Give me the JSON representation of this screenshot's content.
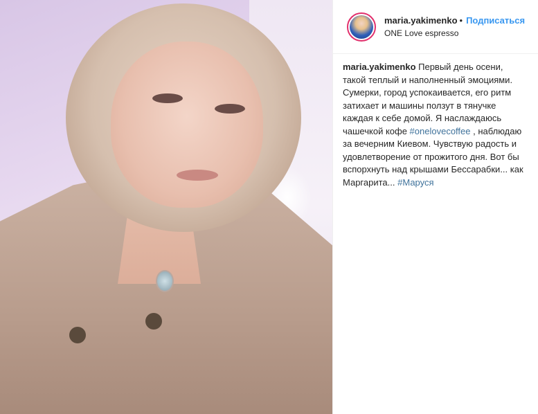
{
  "post": {
    "username": "maria.yakimenko",
    "separator": "•",
    "follow_label": "Подписаться",
    "location": "ONE Love espresso"
  },
  "caption": {
    "username": "maria.yakimenko",
    "part1": " Первый день осени, такой теплый и наполненный эмоциями. Сумерки, город успокаивается, его ритм затихает и машины ползут в тянучке каждая к себе домой. Я наслаждаюсь чашечкой кофе ",
    "hashtag1": "#onelovecoffee",
    "part2": " , наблюдаю за вечерним Киевом. Чувствую радость и удовлетворение от прожитого дня. Вот бы вспорхнуть над крышами Бессарабки... как Маргарита... ",
    "hashtag2": "#Маруся"
  },
  "icons": {
    "avatar": "profile-avatar",
    "photo": "post-photo"
  },
  "colors": {
    "follow": "#3897f0",
    "hashtag": "#3f729b",
    "story_ring": "#e1306c"
  }
}
